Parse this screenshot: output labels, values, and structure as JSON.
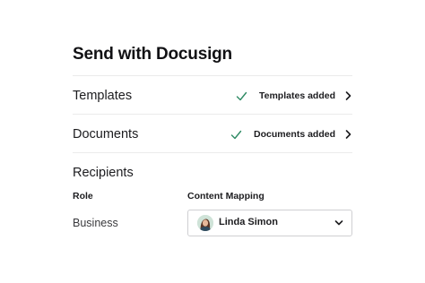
{
  "page_title": "Send with Docusign",
  "rows": [
    {
      "label": "Templates",
      "status": "Templates added"
    },
    {
      "label": "Documents",
      "status": "Documents added"
    }
  ],
  "recipients": {
    "title": "Recipients",
    "columns": {
      "role": "Role",
      "mapping": "Content Mapping"
    },
    "entries": [
      {
        "role": "Business",
        "mapping_value": "Linda Simon"
      }
    ]
  },
  "icons": {
    "check": "check-icon",
    "chevron_right": "chevron-right-icon",
    "chevron_down": "chevron-down-icon"
  },
  "colors": {
    "check": "#2e8a64",
    "text": "#1c1c1f",
    "divider": "#ebebeb",
    "select_border": "#cfcfd2"
  }
}
